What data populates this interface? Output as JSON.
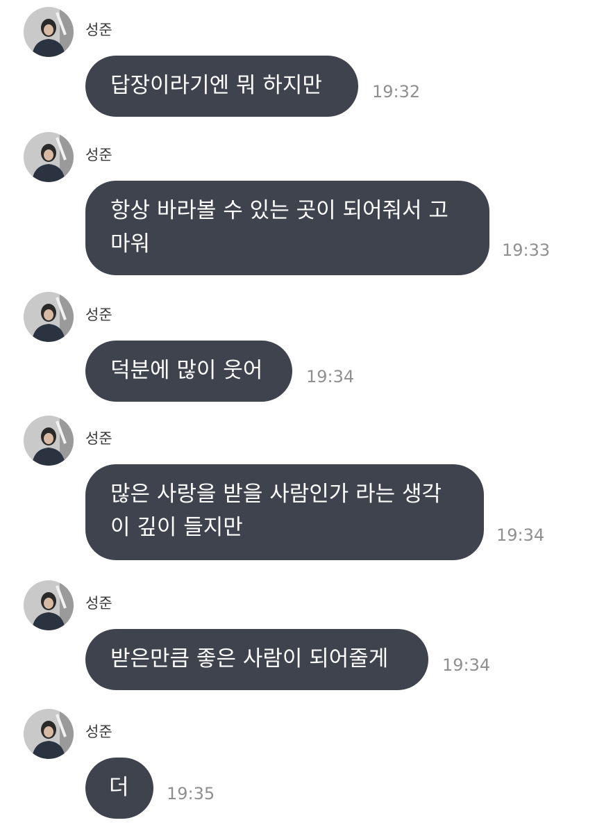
{
  "messages": [
    {
      "sender": "성준",
      "text": "답장이라기엔 뭐 하지만",
      "time": "19:32"
    },
    {
      "sender": "성준",
      "text": "항상 바라볼 수 있는 곳이 되어줘서 고\n마워",
      "time": "19:33"
    },
    {
      "sender": "성준",
      "text": "덕분에 많이 웃어",
      "time": "19:34"
    },
    {
      "sender": "성준",
      "text": "많은 사랑을 받을 사람인가 라는 생각\n이 깊이 들지만",
      "time": "19:34"
    },
    {
      "sender": "성준",
      "text": "받은만큼 좋은 사람이 되어줄게",
      "time": "19:34"
    },
    {
      "sender": "성준",
      "text": "더",
      "time": "19:35"
    }
  ],
  "colors": {
    "bubble": "#3e434d",
    "bubble_text": "#ffffff",
    "time_text": "#8f8f8f",
    "sender_text": "#3a3a3a"
  },
  "icons": {
    "avatar": "profile-photo"
  }
}
